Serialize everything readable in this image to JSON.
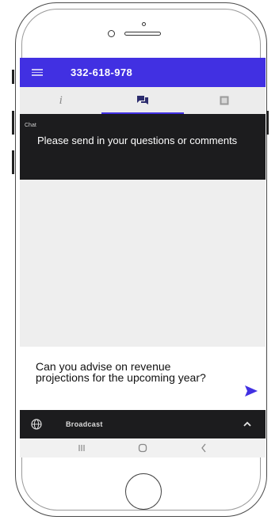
{
  "appbar": {
    "phone_number": "332-618-978"
  },
  "tabs": [
    {
      "name": "info",
      "label": "i",
      "icon": "info-icon",
      "active": false
    },
    {
      "name": "chat",
      "label": "",
      "icon": "chat-icon",
      "active": true
    },
    {
      "name": "media",
      "label": "",
      "icon": "media-icon",
      "active": false
    }
  ],
  "chat": {
    "label": "Chat",
    "message": "Please send in your questions or comments"
  },
  "composer": {
    "value": "Can you advise on revenue projections for the upcoming year?",
    "send_icon": "send-icon"
  },
  "broadcast": {
    "label": "Broadcast",
    "icon": "globe-icon"
  },
  "colors": {
    "accent": "#4130e2",
    "dark_bar": "#1c1c1e",
    "tab_bg": "#ececec",
    "chat_bg": "#eeeeee"
  }
}
